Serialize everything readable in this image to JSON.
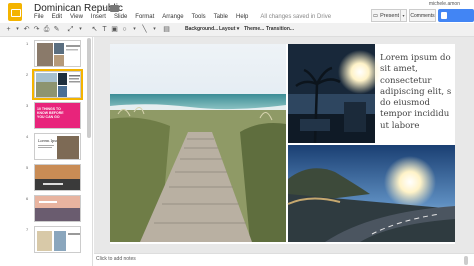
{
  "header": {
    "doc_title": "Dominican Republic",
    "star_icon": "star-icon",
    "folder_icon": "folder-icon",
    "user_email": "michele.amon",
    "present_label": "Present",
    "comments_label": "Comments"
  },
  "menu": {
    "items": [
      "File",
      "Edit",
      "View",
      "Insert",
      "Slide",
      "Format",
      "Arrange",
      "Tools",
      "Table",
      "Help"
    ],
    "saved_status": "All changes saved in Drive"
  },
  "toolbar": {
    "background_label": "Background...",
    "layout_label": "Layout ▾",
    "theme_label": "Theme...",
    "transition_label": "Transition..."
  },
  "filmstrip": {
    "slides": [
      "1",
      "2",
      "3",
      "4",
      "5",
      "6",
      "7"
    ],
    "selected": "2",
    "slide3_text": "10 THINGS TO KNOW BEFORE YOU CAN GO",
    "slide4_text": "Lorem Ipsum"
  },
  "slide": {
    "body_lines": [
      "Lorem ipsum do",
      "sit amet,",
      "consectetur",
      "adipiscing elit, s",
      "do eiusmod",
      "tempor incididu",
      "ut labore"
    ]
  },
  "notes": {
    "placeholder": "Click to add notes"
  },
  "colors": {
    "accent": "#4285f4",
    "brand": "#f4b400",
    "pink": "#e8247b"
  }
}
